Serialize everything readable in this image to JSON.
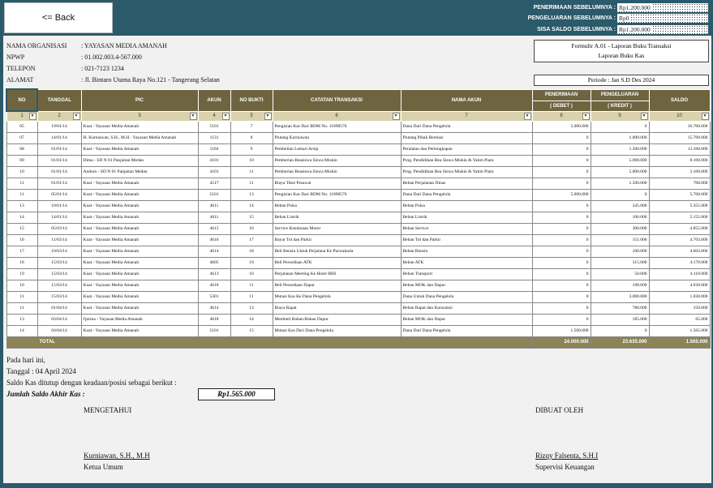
{
  "topbar": {
    "back_label": "<= Back",
    "summary": [
      {
        "label": "PENERIMAAN SEBELUMNYA :",
        "value": "Rp1.200.000"
      },
      {
        "label": "PENGELUARAN SEBELUMNYA :",
        "value": "Rp0"
      },
      {
        "label": "SISA SALDO SEBELUMNYA :",
        "value": "Rp1.200.000"
      }
    ]
  },
  "org": {
    "nama_label": "NAMA ORGANISASI",
    "nama": ": YAYASAN MEDIA AMANAH",
    "npwp_label": "NPWP",
    "npwp": ": 01.002.003.4-567.000",
    "telepon_label": "TELEPON",
    "telepon": ": 021-7123 1234",
    "alamat_label": "ALAMAT",
    "alamat": ": Jl. Bintaro Utama Raya No.121 - Tangerang Selatan"
  },
  "form": {
    "line1": "Formulir A.01 - Laporan Buku Transaksi",
    "line2": "Laporan Buku Kas",
    "periode": "Periode : Jan S.D Des 2024"
  },
  "table": {
    "headers": {
      "no": "NO",
      "tanggal": "TANGGAL",
      "pic": "PIC",
      "akun": "AKUN",
      "no_bukti": "NO BUKTI",
      "catatan": "CATATAN TRANSAKSI",
      "nama_akun": "NAMA AKUN",
      "penerimaan": "PENERIMAAN",
      "debet": "( DEBET )",
      "pengeluaran": "PENGELUARAN",
      "kredit": "( KREDIT )",
      "saldo": "SALDO"
    },
    "col_numbers": [
      "1",
      "2",
      "3",
      "4",
      "5",
      "6",
      "7",
      "8",
      "9",
      "10"
    ],
    "rows": [
      [
        "05",
        "19/01/14",
        "Kuat - Yayasan Media Amanah",
        "5101",
        "7",
        "Pengisian Kas Dari BDM No. 11898576",
        "Dana Dari Dana Pengelola",
        "5.000.000",
        "0",
        "16.700.000"
      ],
      [
        "07",
        "14/01/14",
        "H. Kurniawan, S.H., M.H - Yayasan Media Amanah",
        "1131",
        "8",
        "Piutang Kurniawan",
        "Piutang Pihak Berelasi",
        "0",
        "1.000.000",
        "15.700.000"
      ],
      [
        "08",
        "01/01/14",
        "Kuat - Yayasan Media Amanah",
        "1104",
        "9",
        "Pembelian Lemari Arsip",
        "Peralatan dan Perlengkapan",
        "0",
        "1.500.000",
        "13.100.000"
      ],
      [
        "09",
        "01/01/14",
        "Dima - SD N 01 Panjaitan Medan",
        "4101",
        "10",
        "Pemberian Beasiswa Siswa Miskin",
        "Prog. Pendidikan Bea Siswa Miskin & Yatim Piatu",
        "0",
        "5.000.000",
        "8.100.000"
      ],
      [
        "10",
        "01/01/14",
        "Andoro - SD N 01 Panjaitan Medan",
        "4101",
        "11",
        "Pemberian Beasiswa Siswa Miskin",
        "Prog. Pendidikan Bea Siswa Miskin & Yatim Piatu",
        "0",
        "5.000.000",
        "3.100.000"
      ],
      [
        "11",
        "01/01/14",
        "Kuat - Yayasan Media Amanah",
        "4517",
        "11",
        "Biaya Tiket Pesawat",
        "Beban Perjalanan Dinas",
        "0",
        "1.500.000",
        "700.000"
      ],
      [
        "11",
        "05/01/14",
        "Kuat - Yayasan Media Amanah",
        "5101",
        "13",
        "Pengisian Kas Dari BDM No. 11898576",
        "Dana Dari Dana Pengelola",
        "5.000.000",
        "0",
        "5.700.000"
      ],
      [
        "13",
        "10/01/14",
        "Kuat - Yayasan Media Amanah",
        "4611",
        "14",
        "Beban Pulsa",
        "Beban Pulsa",
        "0",
        "345.000",
        "5.355.000"
      ],
      [
        "14",
        "14/01/14",
        "Kuat - Yayasan Media Amanah",
        "4611",
        "15",
        "Beban Listrik",
        "Beban Listrik",
        "0",
        "100.000",
        "5.155.000"
      ],
      [
        "15",
        "05/03/14",
        "Kuat - Yayasan Media Amanah",
        "4615",
        "16",
        "Service Kendaraan Motor",
        "Beban Service",
        "0",
        "300.000",
        "4.855.000"
      ],
      [
        "16",
        "11/03/14",
        "Kuat - Yayasan Media Amanah",
        "4616",
        "17",
        "Bayar Tol dan Parkir",
        "Beban Tol dan Parkir",
        "0",
        "151.000",
        "4.703.000"
      ],
      [
        "17",
        "10/03/14",
        "Kuat - Yayasan Media Amanah",
        "4614",
        "18",
        "Beli Bensin Untuk Perjalana Ke Purwakarta",
        "Beban Bensin",
        "0",
        "100.000",
        "4.603.000"
      ],
      [
        "18",
        "15/03/14",
        "Kuat - Yayasan Media Amanah",
        "4605",
        "19",
        "Beli Persediaan ATK",
        "Beban ATK",
        "0",
        "315.000",
        "4.178.000"
      ],
      [
        "19",
        "15/03/14",
        "Kuat - Yayasan Media Amanah",
        "4613",
        "10",
        "Perjalanan Meeting Ke Hotel IBIS",
        "Beban Transport",
        "0",
        "50.000",
        "4.118.000"
      ],
      [
        "10",
        "15/03/14",
        "Kuat - Yayasan Media Amanah",
        "4618",
        "11",
        "Beli Persediaan Dapur",
        "Beban MOK dan Dapur",
        "0",
        "198.000",
        "4.030.000"
      ],
      [
        "11",
        "15/03/14",
        "Kuat - Yayasan Media Amanah",
        "5301",
        "11",
        "Mutasi Kas Ke Dana Pengelola",
        "Dana Untuk Dana Pengelola",
        "0",
        "3.000.000",
        "1.030.000"
      ],
      [
        "11",
        "01/04/14",
        "Kuat - Yayasan Media Amanah",
        "4614",
        "13",
        "Biaya Rapat",
        "Beban Rapat dan Konsumsi",
        "0",
        "780.000",
        "150.000"
      ],
      [
        "13",
        "03/04/14",
        "Qurma - Yayasan Media Amanah",
        "4618",
        "14",
        "Membeli Bahan-Bahan Dapur",
        "Beban MOK dan Dapur",
        "0",
        "185.000",
        "65.000"
      ],
      [
        "14",
        "04/04/14",
        "Kuat - Yayasan Media Amanah",
        "5101",
        "15",
        "Mutasi Kas Dari Dana Pengelola",
        "Dana Dari Dana Pengelola",
        "1.500.000",
        "0",
        "1.565.000"
      ]
    ],
    "total_label": "TOTAL",
    "total_debet": "24.000.000",
    "total_kredit": "23.635.000",
    "total_saldo": "1.565.000"
  },
  "footer": {
    "line1": "Pada hari ini,",
    "line2": "Tanggal : 04 April 2024",
    "line3": "Saldo Kas ditutup dengan keadaan/posisi sebagai berikut :",
    "saldo_label": "Jumlah Saldo Akhir Kas :",
    "saldo_value": "Rp1.565.000",
    "mengetahui": "MENGETAHUI",
    "dibuat": "DIBUAT OLEH",
    "sign1_name": "Kurniawan, S.H., M.H",
    "sign1_role": "Ketua Umum",
    "sign2_name": "Rizqy Falsenta, S.H.I",
    "sign2_role": "Supervisi Keuangan"
  },
  "colors": {
    "frame": "#2b5a6a",
    "header": "#6e6540",
    "total": "#8c8356"
  }
}
